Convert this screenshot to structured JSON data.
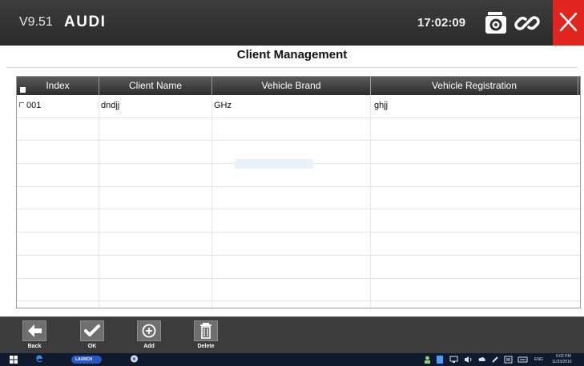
{
  "header": {
    "version": "V9.51",
    "make": "AUDI",
    "time": "17:02:09"
  },
  "icons": {
    "camera": "camera-icon",
    "link": "link-icon",
    "close": "close-icon"
  },
  "colors": {
    "close_button": "#e2241f",
    "header_bg": "#2a2a2a"
  },
  "page": {
    "title": "Client Management"
  },
  "table": {
    "columns": [
      "Index",
      "Client Name",
      "Vehicle Brand",
      "Vehicle Registration"
    ],
    "rows": [
      {
        "index": "001",
        "client_name": "dndjj",
        "vehicle_brand": "GHz",
        "vehicle_registration": "ghjj"
      }
    ]
  },
  "toolbar": {
    "back_label": "Back",
    "ok_label": "OK",
    "add_label": "Add",
    "delete_label": "Delete"
  },
  "taskbar": {
    "lang": "ENG",
    "time": "5:02 PM",
    "date": "11/23/2016",
    "app_badge": "LAUNCH"
  }
}
